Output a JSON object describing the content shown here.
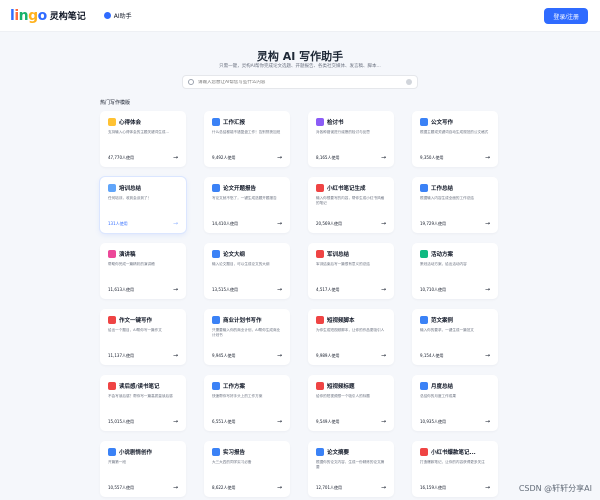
{
  "header": {
    "logo_text": "lingo",
    "logo_cn": "灵构笔记",
    "nav_ai": "AI助手",
    "login": "登录/注册"
  },
  "hero": {
    "title": "灵构 AI 写作助手",
    "subtitle": "只需一键，灵构AI帮你完成论文选题、开题报告、各类社交媒体、发言稿、脚本...",
    "search_placeholder": "请输入您想让AI帮您写些什么内容"
  },
  "section": {
    "title": "热门写作模版"
  },
  "colors": {
    "accent": "#2f6bff"
  },
  "cards": [
    {
      "title": "心得体会",
      "desc": "支持输入心得体会的主题关键词生成...",
      "uses": "47,770人使用",
      "icon": "lightbulb-icon",
      "color": "#ffc233"
    },
    {
      "title": "工作汇报",
      "desc": "什么总结都能不错复盘工作！告别熬夜加班",
      "uses": "9,492人使用",
      "icon": "briefcase-icon",
      "color": "#3b82f6"
    },
    {
      "title": "检讨书",
      "desc": "对各种错误进行诚恳的检讨与反思",
      "uses": "8,165人使用",
      "icon": "pen-icon",
      "color": "#8b5cf6"
    },
    {
      "title": "公文写作",
      "desc": "根据主题或关键词自动生成规范的公文格式",
      "uses": "9,350人使用",
      "icon": "document-icon",
      "color": "#3b82f6"
    },
    {
      "title": "培训总结",
      "desc": "任何培训，收到会谈到了！",
      "uses": "131人使用",
      "icon": "chart-icon",
      "color": "#60a5fa",
      "active": true
    },
    {
      "title": "论文开题报告",
      "desc": "写论文就不愁了，一键生成选题开题报告",
      "uses": "14,410人使用",
      "icon": "report-icon",
      "color": "#3b82f6"
    },
    {
      "title": "小红书笔记生成",
      "desc": "输入你想要写的内容，帮你生成小红书风格的笔记",
      "uses": "20,569人使用",
      "icon": "note-icon",
      "color": "#ef4444"
    },
    {
      "title": "工作总结",
      "desc": "根据输入内容生成全面的工作总结",
      "uses": "19,729人使用",
      "icon": "folder-icon",
      "color": "#3b82f6"
    },
    {
      "title": "演讲稿",
      "desc": "帮助你完成一篇精彩的演讲稿",
      "uses": "11,613人使用",
      "icon": "mic-icon",
      "color": "#ec4899"
    },
    {
      "title": "论文大纲",
      "desc": "输入论文题目，可以生成论文的大纲",
      "uses": "13,515人使用",
      "icon": "outline-icon",
      "color": "#3b82f6"
    },
    {
      "title": "军训总结",
      "desc": "军训结束后写一篇很有意义的总结",
      "uses": "4,517人使用",
      "icon": "flag-icon",
      "color": "#ef4444"
    },
    {
      "title": "活动方案",
      "desc": "策划活动方案，给出活动内容",
      "uses": "10,710人使用",
      "icon": "megaphone-icon",
      "color": "#10b981"
    },
    {
      "title": "作文一键写作",
      "desc": "给出一个题目，AI帮你写一篇作文",
      "uses": "11,137人使用",
      "icon": "essay-icon",
      "color": "#ef4444"
    },
    {
      "title": "商业计划书写作",
      "desc": "只需要输入你的商业计划，AI帮你生成商业计划书",
      "uses": "9,945人使用",
      "icon": "business-icon",
      "color": "#3b82f6"
    },
    {
      "title": "短视频脚本",
      "desc": "为你生成短视频脚本，让你的作品更吸引人",
      "uses": "9,989人使用",
      "icon": "video-icon",
      "color": "#ef4444"
    },
    {
      "title": "范文案例",
      "desc": "输入你的要求，一键生成一篇范文",
      "uses": "9,154人使用",
      "icon": "book-icon",
      "color": "#3b82f6"
    },
    {
      "title": "读后感/读书笔记",
      "desc": "不会写读后感？帮你写一篇高质量读后感",
      "uses": "15,015人使用",
      "icon": "reading-icon",
      "color": "#ef4444"
    },
    {
      "title": "工作方案",
      "desc": "快速帮你写好手头上的工作方案",
      "uses": "6,551人使用",
      "icon": "plan-icon",
      "color": "#3b82f6"
    },
    {
      "title": "短视频标题",
      "desc": "给你的短视频想一个吸引人的标题",
      "uses": "9,549人使用",
      "icon": "title-icon",
      "color": "#ef4444"
    },
    {
      "title": "月度总结",
      "desc": "总结你的月度工作成果",
      "uses": "10,935人使用",
      "icon": "calendar-icon",
      "color": "#3b82f6"
    },
    {
      "title": "小说剧情创作",
      "desc": "开篇第一段",
      "uses": "10,557人使用",
      "icon": "novel-icon",
      "color": "#3b82f6"
    },
    {
      "title": "实习报告",
      "desc": "大三大四的同学实习必备",
      "uses": "8,622人使用",
      "icon": "intern-icon",
      "color": "#3b82f6"
    },
    {
      "title": "论文摘要",
      "desc": "根据你的论文内容，生成一份精炼的论文摘要",
      "uses": "12,701人使用",
      "icon": "abstract-icon",
      "color": "#3b82f6"
    },
    {
      "title": "小红书爆款笔记...",
      "desc": "打造爆款笔记，让你的内容获得更多关注",
      "uses": "16,159人使用",
      "icon": "hot-icon",
      "color": "#ef4444"
    }
  ],
  "watermark": "CSDN @轩轩分享AI"
}
